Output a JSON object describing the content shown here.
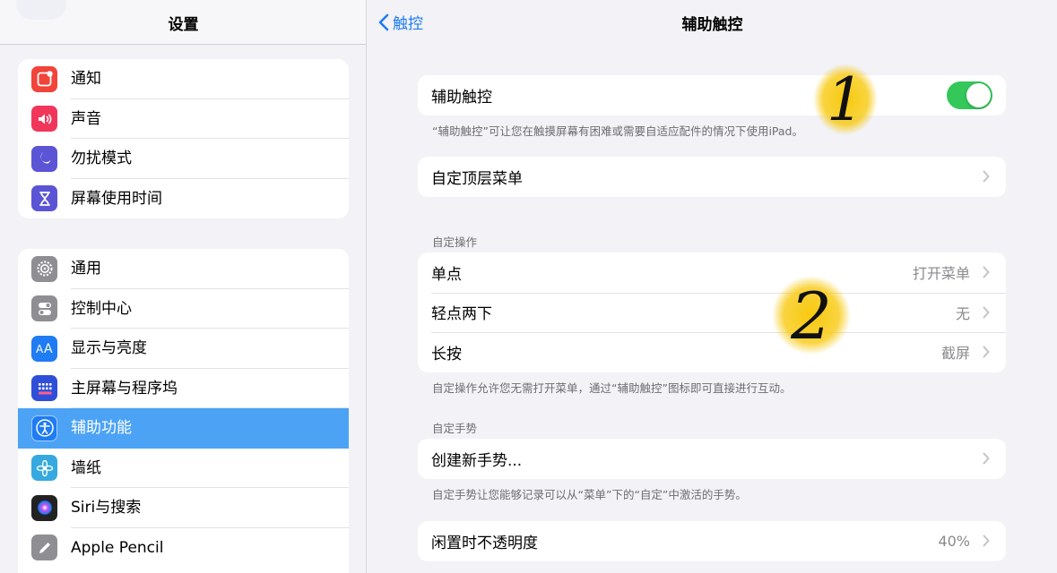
{
  "sidebar": {
    "title": "设置",
    "group1": [
      {
        "label": "通知",
        "icon": "notifications-icon",
        "color": "#f1443a"
      },
      {
        "label": "声音",
        "icon": "sound-icon",
        "color": "#f0365b"
      },
      {
        "label": "勿扰模式",
        "icon": "moon-icon",
        "color": "#5b55d5"
      },
      {
        "label": "屏幕使用时间",
        "icon": "hourglass-icon",
        "color": "#5b55d5"
      }
    ],
    "group2": [
      {
        "label": "通用",
        "icon": "gear-icon",
        "color": "#8e8e93"
      },
      {
        "label": "控制中心",
        "icon": "toggles-icon",
        "color": "#8e8e93"
      },
      {
        "label": "显示与亮度",
        "icon": "text-size-icon",
        "color": "#1f7cf2"
      },
      {
        "label": "主屏幕与程序坞",
        "icon": "grid-icon",
        "color": "#2f4fd8"
      },
      {
        "label": "辅助功能",
        "icon": "accessibility-icon",
        "color": "#1f7cf2",
        "selected": true
      },
      {
        "label": "墙纸",
        "icon": "flower-icon",
        "color": "#35a9e0"
      },
      {
        "label": "Siri与搜索",
        "icon": "siri-icon",
        "color": "#222222"
      },
      {
        "label": "Apple Pencil",
        "icon": "pencil-icon",
        "color": "#8e8e93"
      }
    ]
  },
  "detail": {
    "back_label": "触控",
    "title": "辅助触控",
    "assistive_touch": {
      "label": "辅助触控",
      "enabled": true
    },
    "assistive_touch_footer": "“辅助触控”可让您在触摸屏幕有困难或需要自适应配件的情况下使用iPad。",
    "top_menu": {
      "label": "自定顶层菜单"
    },
    "custom_actions_header": "自定操作",
    "custom_actions": [
      {
        "label": "单点",
        "value": "打开菜单"
      },
      {
        "label": "轻点两下",
        "value": "无"
      },
      {
        "label": "长按",
        "value": "截屏"
      }
    ],
    "custom_actions_footer": "自定操作允许您无需打开菜单，通过“辅助触控”图标即可直接进行互动。",
    "custom_gestures_header": "自定手势",
    "create_gesture": {
      "label": "创建新手势..."
    },
    "custom_gestures_footer": "自定手势让您能够记录可以从“菜单”下的“自定”中激活的手势。",
    "idle_opacity": {
      "label": "闲置时不透明度",
      "value": "40%"
    }
  },
  "annotations": [
    {
      "label": "1",
      "color": "#f7c600"
    },
    {
      "label": "2",
      "color": "#f7c600"
    }
  ],
  "colors": {
    "accent": "#1f7cf2",
    "selected_row": "#4ca3f5",
    "toggle_on": "#34c759",
    "background": "#f2f2f7"
  }
}
